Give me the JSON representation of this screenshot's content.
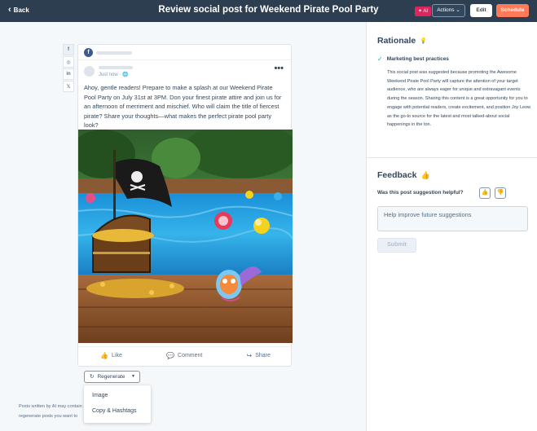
{
  "header": {
    "back_label": "Back",
    "title": "Review social post for Weekend Pirate Pool Party",
    "ai_badge": "AI",
    "actions_label": "Actions",
    "edit_label": "Edit",
    "schedule_label": "Schedule"
  },
  "social_tabs": [
    "f",
    "◎",
    "in",
    "𝕏"
  ],
  "post": {
    "timestamp": "Just now · 🌐",
    "text": "Ahoy, gentle readers! Prepare to make a splash at our Weekend Pirate Pool Party on July 31st at 3PM. Don your finest pirate attire and join us for an afternoon of merriment and mischief. Who will claim the title of fiercest pirate? Share your thoughts—what makes the perfect pirate pool party look?",
    "actions": {
      "like": "Like",
      "comment": "Comment",
      "share": "Share"
    }
  },
  "regenerate": {
    "label": "Regenerate",
    "menu": [
      "Image",
      "Copy & Hashtags"
    ]
  },
  "disclaimer": {
    "line1": "Posts written by AI may contain",
    "line2": "regenerate posts you want to"
  },
  "rationale": {
    "title": "Rationale",
    "item_title": "Marketing best practices",
    "text": "This social post was suggested because promoting the Awesome Weekend Pirate Pool Party will capture the attention of your target audience, who are always eager for unique and extravagant events during the season. Sharing this content is a great opportunity for you to engage with potential readers, create excitement, and position Joy Leow as the go-to source for the latest and most talked-about social happenings in the ton."
  },
  "feedback": {
    "title": "Feedback",
    "question": "Was this post suggestion helpful?",
    "placeholder": "Help improve future suggestions",
    "submit_label": "Submit"
  }
}
